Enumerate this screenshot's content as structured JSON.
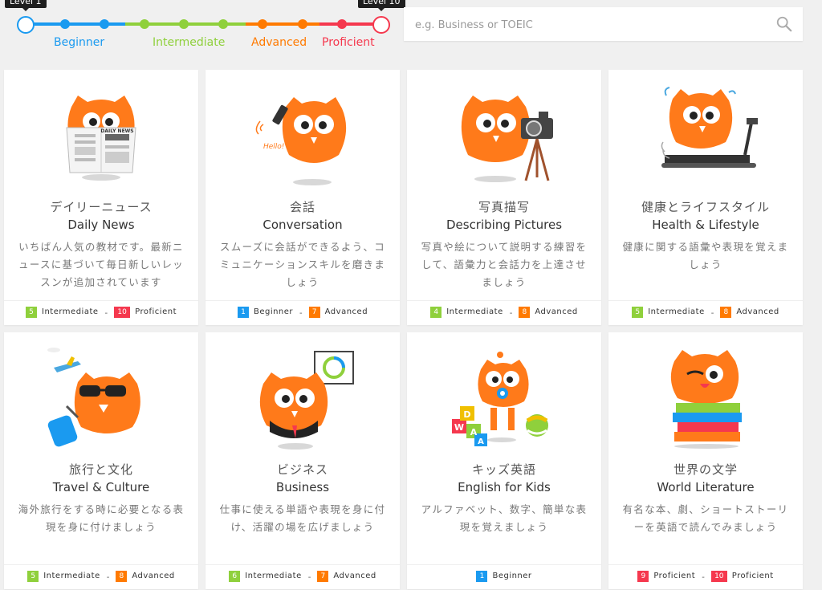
{
  "colors": {
    "beginner": "#1a9af0",
    "intermediate": "#8fd03c",
    "advanced": "#ff7a00",
    "proficient": "#f5384e",
    "owl": "#ff7a1a"
  },
  "slider": {
    "min_tooltip": "Level 1",
    "max_tooltip": "Level 10",
    "selected_min": 1,
    "selected_max": 10,
    "labels": [
      "Beginner",
      "Intermediate",
      "Advanced",
      "Proficient"
    ]
  },
  "search": {
    "placeholder": "e.g. Business or TOEIC",
    "value": "",
    "icon": "search-icon"
  },
  "cards": [
    {
      "title_jp": "デイリーニュース",
      "title_en": "Daily News",
      "description": "いちばん人気の教材です。最新ニュースに基づいて毎日新しいレッスンが追加されています",
      "illustration": "owl-reading-newspaper",
      "newspaper_text": "DAILY NEWS",
      "min": {
        "num": "5",
        "label": "Intermediate",
        "color": "#8fd03c"
      },
      "max": {
        "num": "10",
        "label": "Proficient",
        "color": "#f5384e"
      }
    },
    {
      "title_jp": "会話",
      "title_en": "Conversation",
      "description": "スムーズに会話ができるよう、コミュニケーションスキルを磨きましょう",
      "illustration": "owl-on-phone",
      "bubble_text": "Hello!",
      "min": {
        "num": "1",
        "label": "Beginner",
        "color": "#1a9af0"
      },
      "max": {
        "num": "7",
        "label": "Advanced",
        "color": "#ff7a00"
      }
    },
    {
      "title_jp": "写真描写",
      "title_en": "Describing Pictures",
      "description": "写真や絵について説明する練習をして、語彙力と会話力を上達させましょう",
      "illustration": "owl-with-camera",
      "min": {
        "num": "4",
        "label": "Intermediate",
        "color": "#8fd03c"
      },
      "max": {
        "num": "8",
        "label": "Advanced",
        "color": "#ff7a00"
      }
    },
    {
      "title_jp": "健康とライフスタイル",
      "title_en": "Health & Lifestyle",
      "description": "健康に関する語彙や表現を覚えましょう",
      "illustration": "owl-on-treadmill",
      "min": {
        "num": "5",
        "label": "Intermediate",
        "color": "#8fd03c"
      },
      "max": {
        "num": "8",
        "label": "Advanced",
        "color": "#ff7a00"
      }
    },
    {
      "title_jp": "旅行と文化",
      "title_en": "Travel & Culture",
      "description": "海外旅行をする時に必要となる表現を身に付けましょう",
      "illustration": "owl-traveling",
      "min": {
        "num": "5",
        "label": "Intermediate",
        "color": "#8fd03c"
      },
      "max": {
        "num": "8",
        "label": "Advanced",
        "color": "#ff7a00"
      }
    },
    {
      "title_jp": "ビジネス",
      "title_en": "Business",
      "description": "仕事に使える単語や表現を身に付け、活躍の場を広げましょう",
      "illustration": "owl-presenting",
      "min": {
        "num": "6",
        "label": "Intermediate",
        "color": "#8fd03c"
      },
      "max": {
        "num": "7",
        "label": "Advanced",
        "color": "#ff7a00"
      }
    },
    {
      "title_jp": "キッズ英語",
      "title_en": "English for Kids",
      "description": "アルファベット、数字、簡単な表現を覚えましょう",
      "illustration": "baby-owl-with-blocks",
      "blocks_text": [
        "W",
        "A",
        "D",
        "A"
      ],
      "min": {
        "num": "1",
        "label": "Beginner",
        "color": "#1a9af0"
      },
      "max": null
    },
    {
      "title_jp": "世界の文学",
      "title_en": "World Literature",
      "description": "有名な本、劇、ショートストーリーを英語で読んでみましょう",
      "illustration": "owl-on-books",
      "min": {
        "num": "9",
        "label": "Proficient",
        "color": "#f5384e"
      },
      "max": {
        "num": "10",
        "label": "Proficient",
        "color": "#f5384e"
      }
    }
  ]
}
